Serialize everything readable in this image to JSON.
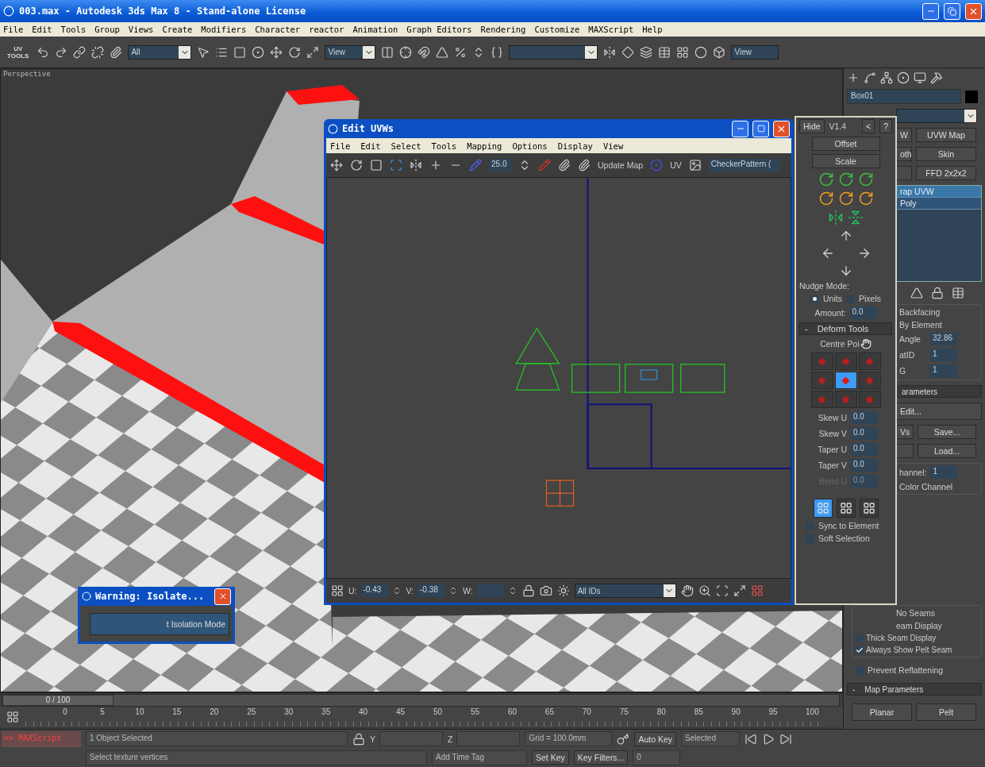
{
  "window": {
    "title": "003.max - Autodesk 3ds Max 8  - Stand-alone License"
  },
  "menu": [
    "File",
    "Edit",
    "Tools",
    "Group",
    "Views",
    "Create",
    "Modifiers",
    "Character",
    "reactor",
    "Animation",
    "Graph Editors",
    "Rendering",
    "Customize",
    "MAXScript",
    "Help"
  ],
  "toolbar": {
    "uv_tools": [
      "UV",
      "TOOLS"
    ],
    "selection_filter": "All",
    "reference_coord": "View",
    "render_view": "View"
  },
  "viewport": {
    "label": "Perspective"
  },
  "uv_editor": {
    "title": "Edit UVWs",
    "menu": [
      "File",
      "Edit",
      "Select",
      "Tools",
      "Mapping",
      "Options",
      "Display",
      "View"
    ],
    "zoom_value": "25.0",
    "update_button": "Update Map",
    "uv_label": "UV",
    "texture_dropdown": "CheckerPattern (",
    "coords": [
      {
        "label": "U:",
        "value": "-0.43"
      },
      {
        "label": "V:",
        "value": "-0.38"
      },
      {
        "label": "W:"
      }
    ],
    "ids_dropdown": "All IDs"
  },
  "tools_panel": {
    "hide": "Hide",
    "version": "V1.4",
    "back": "<",
    "help": "?",
    "buttons": [
      "Offset",
      "Scale"
    ],
    "nudge_label": "Nudge Mode:",
    "nudge_modes": [
      {
        "label": "Units",
        "selected": true
      },
      {
        "label": "Pixels",
        "selected": false
      }
    ],
    "amount_label": "Amount:",
    "amount": "0.0",
    "deform_toggle": "-",
    "deform_title": "Deform Tools",
    "centre_label": "Centre Poi",
    "centre_points": [
      {
        "selected": false
      },
      {
        "selected": false
      },
      {
        "selected": false
      },
      {
        "selected": false
      },
      {
        "selected": true
      },
      {
        "selected": false
      },
      {
        "selected": false
      },
      {
        "selected": false
      },
      {
        "selected": false
      }
    ],
    "fields": [
      {
        "label": "Skew U",
        "value": "0.0",
        "disabled": false
      },
      {
        "label": "Skew V",
        "value": "0.0",
        "disabled": false
      },
      {
        "label": "Taper U",
        "value": "0.0",
        "disabled": false
      },
      {
        "label": "Taper V",
        "value": "0.0",
        "disabled": false
      },
      {
        "label": "Bend U",
        "value": "0.0",
        "disabled": true
      }
    ],
    "select_modes": [
      {
        "selected": true
      },
      {
        "selected": false
      },
      {
        "selected": false
      }
    ],
    "options": [
      {
        "label": "Sync to Element",
        "checked": false
      },
      {
        "label": "Soft Selection",
        "checked": false
      }
    ]
  },
  "command_panel": {
    "object_name": "Box01",
    "modifier_rows": [
      [
        "W",
        "UVW Map"
      ],
      [
        "oth",
        "Skin"
      ],
      [
        "FFD 2x2x2"
      ]
    ],
    "stack": [
      {
        "label": "rap UVW",
        "selected": true
      },
      {
        "label": "Poly",
        "selected": false
      }
    ],
    "selection": [
      "Backfacing",
      "By Element"
    ],
    "spinners": [
      {
        "label": "Angle",
        "value": "32.86"
      },
      {
        "label": "atID",
        "value": "1"
      },
      {
        "label": "G",
        "value": "1"
      }
    ],
    "parameters_title": "arameters",
    "edit_button": "Edit...",
    "save_row": [
      "Vs",
      "Save..."
    ],
    "load_button": "Load...",
    "channel": {
      "label": "hannel:",
      "value": "1"
    },
    "color_channel": "Color Channel",
    "seam_options": [
      {
        "label": "No Seams",
        "kind": "text"
      },
      {
        "label": "eam Display",
        "kind": "text"
      },
      {
        "label": "Thick Seam Display",
        "kind": "radio",
        "selected": false
      },
      {
        "label": "Always Show Pelt Seam",
        "kind": "checkbox",
        "checked": true
      }
    ],
    "prevent": {
      "label": "Prevent Reflattening",
      "checked": false
    },
    "map_toggle": "-",
    "map_title": "Map Parameters",
    "map_buttons": [
      "Planar",
      "Pelt"
    ]
  },
  "warning": {
    "title": "Warning: Isolate...",
    "button": "t Isolation Mode"
  },
  "timeline": {
    "position": "0 / 100",
    "level": 0,
    "ticks": [
      "0",
      "5",
      "10",
      "15",
      "20",
      "25",
      "30",
      "35",
      "40",
      "45",
      "50",
      "55",
      "60",
      "65",
      "70",
      "75",
      "80",
      "85",
      "90",
      "95",
      "100"
    ]
  },
  "status": {
    "script": ">> MAXScript",
    "selection": "1 Object Selected",
    "prompt": "Select texture vertices",
    "coord_labels": [
      "Y",
      "Z"
    ],
    "grid": "Grid = 100.0mm",
    "time_tag": "Add Time Tag",
    "auto_key": "Auto Key",
    "key_mode": "Selected",
    "set_key": "Set Key",
    "key_filters": "Key Filters...",
    "frame": "0"
  }
}
